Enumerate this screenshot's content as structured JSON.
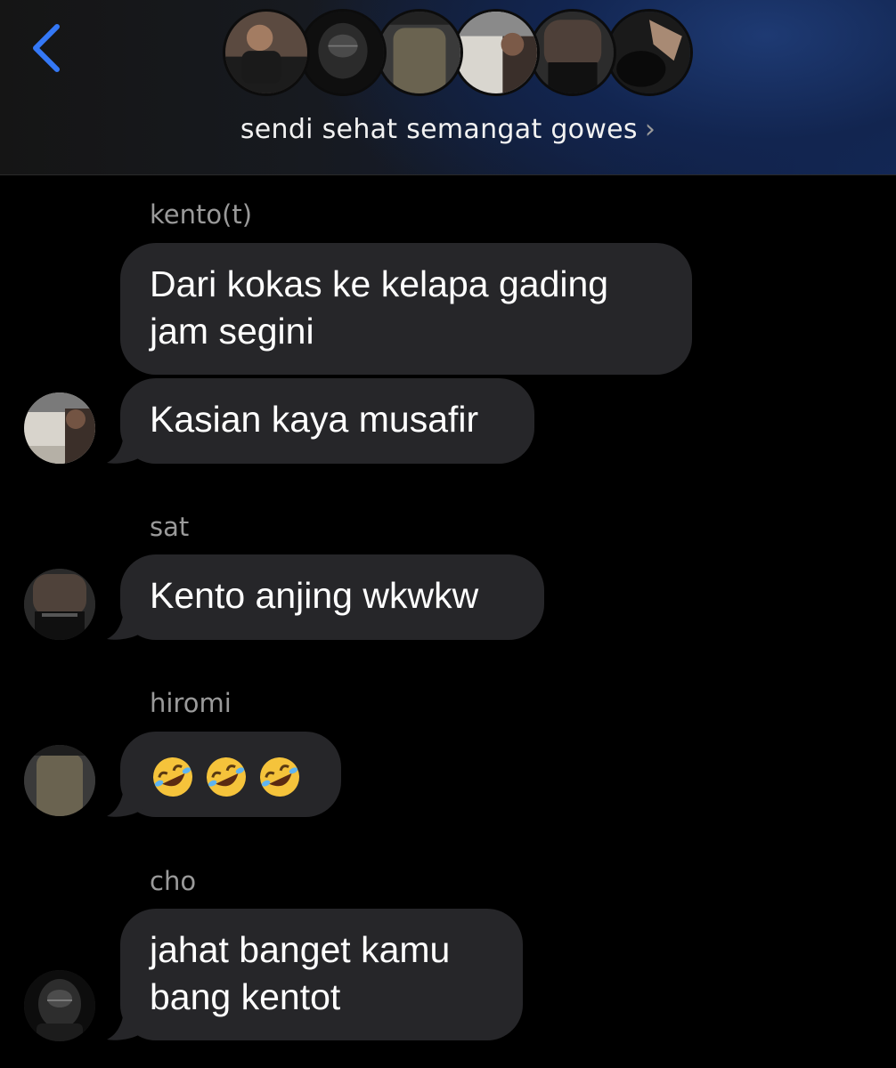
{
  "header": {
    "group_name": "sendi sehat semangat gowes",
    "chevron": "›",
    "back_icon": "chevron-left-icon",
    "accent_color": "#3478f6",
    "member_avatars": [
      "member-avatar-1",
      "member-avatar-2",
      "member-avatar-3",
      "member-avatar-4",
      "member-avatar-5",
      "member-avatar-6"
    ]
  },
  "messages": [
    {
      "sender": "kento(t)",
      "text": "Dari kokas ke kelapa gading jam segini"
    },
    {
      "text": "Kasian kaya musafir"
    },
    {
      "sender": "sat",
      "text": "Kento anjing wkwkw"
    },
    {
      "sender": "hiromi",
      "emoji": [
        "rolling-on-floor-laughing",
        "rolling-on-floor-laughing",
        "rolling-on-floor-laughing"
      ]
    },
    {
      "sender": "cho",
      "text": "jahat banget kamu bang kentot"
    }
  ],
  "colors": {
    "background": "#000000",
    "bubble": "#262629",
    "sender_label": "#9a9a9a",
    "text": "#ffffff"
  }
}
